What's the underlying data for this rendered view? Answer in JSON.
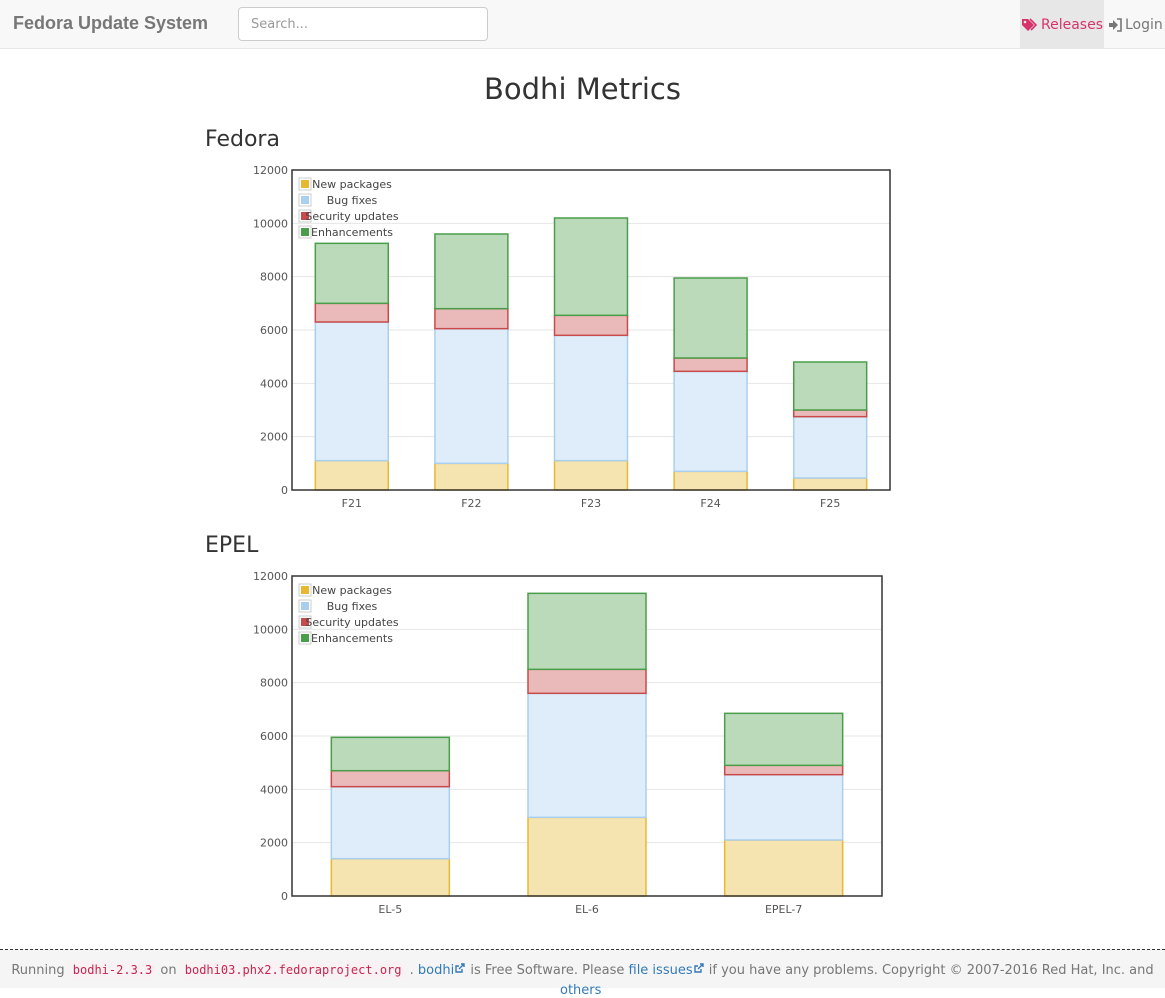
{
  "navbar": {
    "brand": "Fedora Update System",
    "search_placeholder": "Search...",
    "releases_label": "Releases",
    "login_label": "Login",
    "releases_color": "#d6336c"
  },
  "page": {
    "title": "Bodhi Metrics"
  },
  "sections": [
    {
      "title": "Fedora"
    },
    {
      "title": "EPEL"
    }
  ],
  "chart_data": [
    {
      "type": "bar",
      "stacked": true,
      "title": "Fedora",
      "categories": [
        "F21",
        "F22",
        "F23",
        "F24",
        "F25"
      ],
      "ylim": [
        0,
        12000
      ],
      "yticks": [
        0,
        2000,
        4000,
        6000,
        8000,
        10000,
        12000
      ],
      "grid": true,
      "legend_position": "top-left",
      "series": [
        {
          "name": "New packages",
          "values": [
            1100,
            1000,
            1100,
            700,
            450
          ],
          "color": "#e8b830"
        },
        {
          "name": "Bug fixes",
          "values": [
            5200,
            5050,
            4700,
            3750,
            2300
          ],
          "color": "#a9cfee"
        },
        {
          "name": "Security updates",
          "values": [
            700,
            750,
            750,
            500,
            250
          ],
          "color": "#c94a4a"
        },
        {
          "name": "Enhancements",
          "values": [
            2250,
            2800,
            3650,
            3000,
            1800
          ],
          "color": "#4a9e4a"
        }
      ]
    },
    {
      "type": "bar",
      "stacked": true,
      "title": "EPEL",
      "categories": [
        "EL-5",
        "EL-6",
        "EPEL-7"
      ],
      "ylim": [
        0,
        12000
      ],
      "yticks": [
        0,
        2000,
        4000,
        6000,
        8000,
        10000,
        12000
      ],
      "grid": true,
      "legend_position": "top-left",
      "series": [
        {
          "name": "New packages",
          "values": [
            1400,
            2950,
            2100
          ],
          "color": "#e8b830"
        },
        {
          "name": "Bug fixes",
          "values": [
            2700,
            4650,
            2450
          ],
          "color": "#a9cfee"
        },
        {
          "name": "Security updates",
          "values": [
            600,
            900,
            350
          ],
          "color": "#c94a4a"
        },
        {
          "name": "Enhancements",
          "values": [
            1250,
            2850,
            1950
          ],
          "color": "#4a9e4a"
        }
      ]
    }
  ],
  "footer": {
    "running_label": "Running",
    "version": "bodhi-2.3.3",
    "on_label": "on",
    "host": "bodhi03.phx2.fedoraproject.org",
    "bodhi_link": "bodhi",
    "free_text": "is Free Software. Please",
    "issues_link": "file issues",
    "copyright_text": "if you have any problems. Copyright © 2007-2016 Red Hat, Inc. and",
    "others_link": "others"
  }
}
